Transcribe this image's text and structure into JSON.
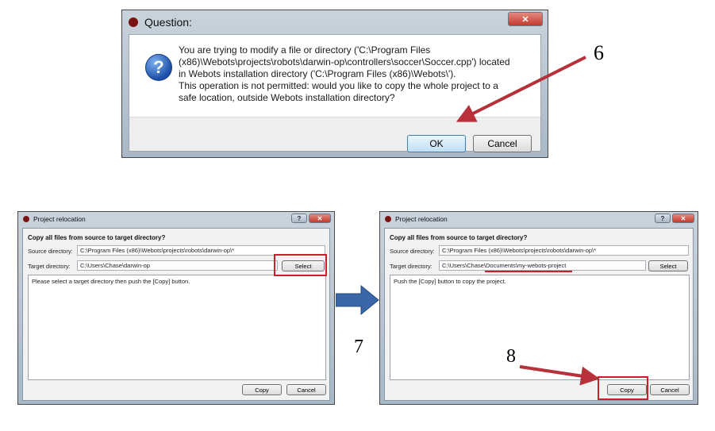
{
  "question_dialog": {
    "title": "Question:",
    "close_glyph": "✕",
    "icon": "question-icon",
    "message": [
      "You are trying to modify a file or directory ('C:\\Program Files",
      "(x86)\\Webots\\projects\\robots\\darwin-op\\controllers\\soccer\\Soccer.cpp') located",
      "in Webots installation directory ('C:\\Program Files (x86)\\Webots\\').",
      "This operation is not permitted: would you like to copy the whole project to a",
      "safe location, outside Webots installation directory?"
    ],
    "ok_label": "OK",
    "cancel_label": "Cancel"
  },
  "relocation_before": {
    "title": "Project relocation",
    "help_glyph": "?",
    "close_glyph": "✕",
    "heading": "Copy all files from source to target directory?",
    "source_label": "Source directory:",
    "source_value": "C:\\Program Files (x86)\\Webots\\projects\\robots\\darwin-op\\*",
    "target_label": "Target directory:",
    "target_value": "C:\\Users\\Chase\\darwin-op",
    "select_label": "Select",
    "info_text": "Please select a target directory then push the [Copy] button.",
    "copy_label": "Copy",
    "cancel_label": "Cancel"
  },
  "relocation_after": {
    "title": "Project relocation",
    "help_glyph": "?",
    "close_glyph": "✕",
    "heading": "Copy all files from source to target directory?",
    "source_label": "Source directory:",
    "source_value": "C:\\Program Files (x86)\\Webots\\projects\\robots\\darwin-op\\*",
    "target_label": "Target directory:",
    "target_value": "C:\\Users\\Chase\\Documents\\my-webots-project",
    "select_label": "Select",
    "info_text": "Push the [Copy] button to copy the project.",
    "copy_label": "Copy",
    "cancel_label": "Cancel"
  },
  "annotations": {
    "step6": "6",
    "step7": "7",
    "step8": "8"
  },
  "colors": {
    "annotation_red": "#cc1f2a",
    "flow_arrow_blue": "#3b67a8",
    "close_button_red": "#c8443a"
  }
}
